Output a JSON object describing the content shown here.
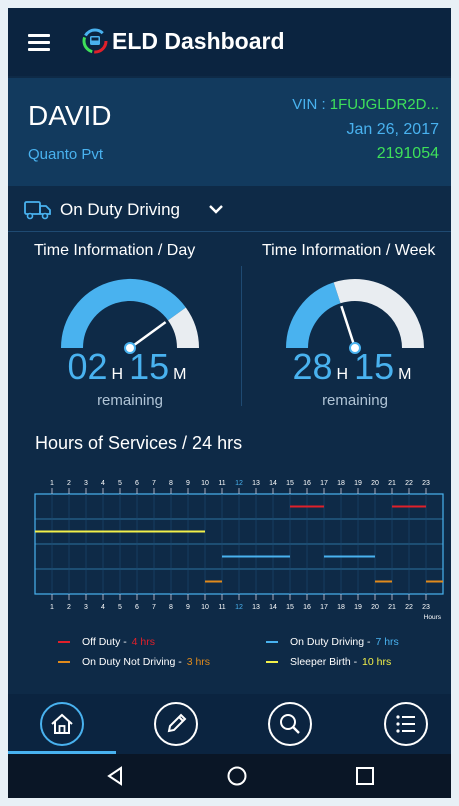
{
  "app": {
    "title": "ELD Dashboard"
  },
  "driver": {
    "name": "DAVID",
    "company": "Quanto Pvt",
    "vin_label": "VIN : ",
    "vin_value": "1FUJGLDR2D...",
    "date": "Jan 26, 2017",
    "number": "2191054"
  },
  "status": {
    "label": "On Duty Driving"
  },
  "day": {
    "title": "Time Information / Day",
    "hours": "02",
    "hour_unit": "H",
    "minutes": "15",
    "minute_unit": "M",
    "remaining": "remaining",
    "used_fraction": 0.8
  },
  "week": {
    "title": "Time Information / Week",
    "hours": "28",
    "hour_unit": "H",
    "minutes": "15",
    "minute_unit": "M",
    "remaining": "remaining",
    "used_fraction": 0.4
  },
  "hos": {
    "title": "Hours of Services / 24 hrs",
    "hours_label": "Hours",
    "ticks": [
      "1",
      "2",
      "3",
      "4",
      "5",
      "6",
      "7",
      "8",
      "9",
      "10",
      "11",
      "12",
      "13",
      "14",
      "15",
      "16",
      "17",
      "18",
      "19",
      "20",
      "21",
      "22",
      "23"
    ],
    "highlight_tick": "12",
    "segments": [
      {
        "status": "sleeper",
        "start": 0,
        "end": 10
      },
      {
        "status": "on_duty_not_driving",
        "start": 10,
        "end": 11
      },
      {
        "status": "on_duty_driving",
        "start": 11,
        "end": 15
      },
      {
        "status": "off_duty",
        "start": 15,
        "end": 17
      },
      {
        "status": "on_duty_driving",
        "start": 17,
        "end": 20
      },
      {
        "status": "on_duty_not_driving",
        "start": 20,
        "end": 21
      },
      {
        "status": "off_duty",
        "start": 21,
        "end": 23
      },
      {
        "status": "on_duty_not_driving",
        "start": 23,
        "end": 24
      }
    ]
  },
  "legend": {
    "off_duty": {
      "label": "Off Duty - ",
      "value": "4 hrs",
      "color": "#e0202a"
    },
    "on_duty_driving": {
      "label": "On Duty Driving - ",
      "value": "7 hrs",
      "color": "#49b2ef"
    },
    "on_duty_not_driving": {
      "label": "On Duty Not Driving - ",
      "value": "3 hrs",
      "color": "#e08a1c"
    },
    "sleeper": {
      "label": "Sleeper Birth - ",
      "value": "10 hrs",
      "color": "#f2f04a"
    }
  },
  "nav": {
    "items": [
      "home-icon",
      "pencil-icon",
      "search-icon",
      "list-icon"
    ]
  },
  "colors": {
    "accent": "#49b2ef",
    "green": "#3ee05a",
    "background": "#0e2a47"
  }
}
